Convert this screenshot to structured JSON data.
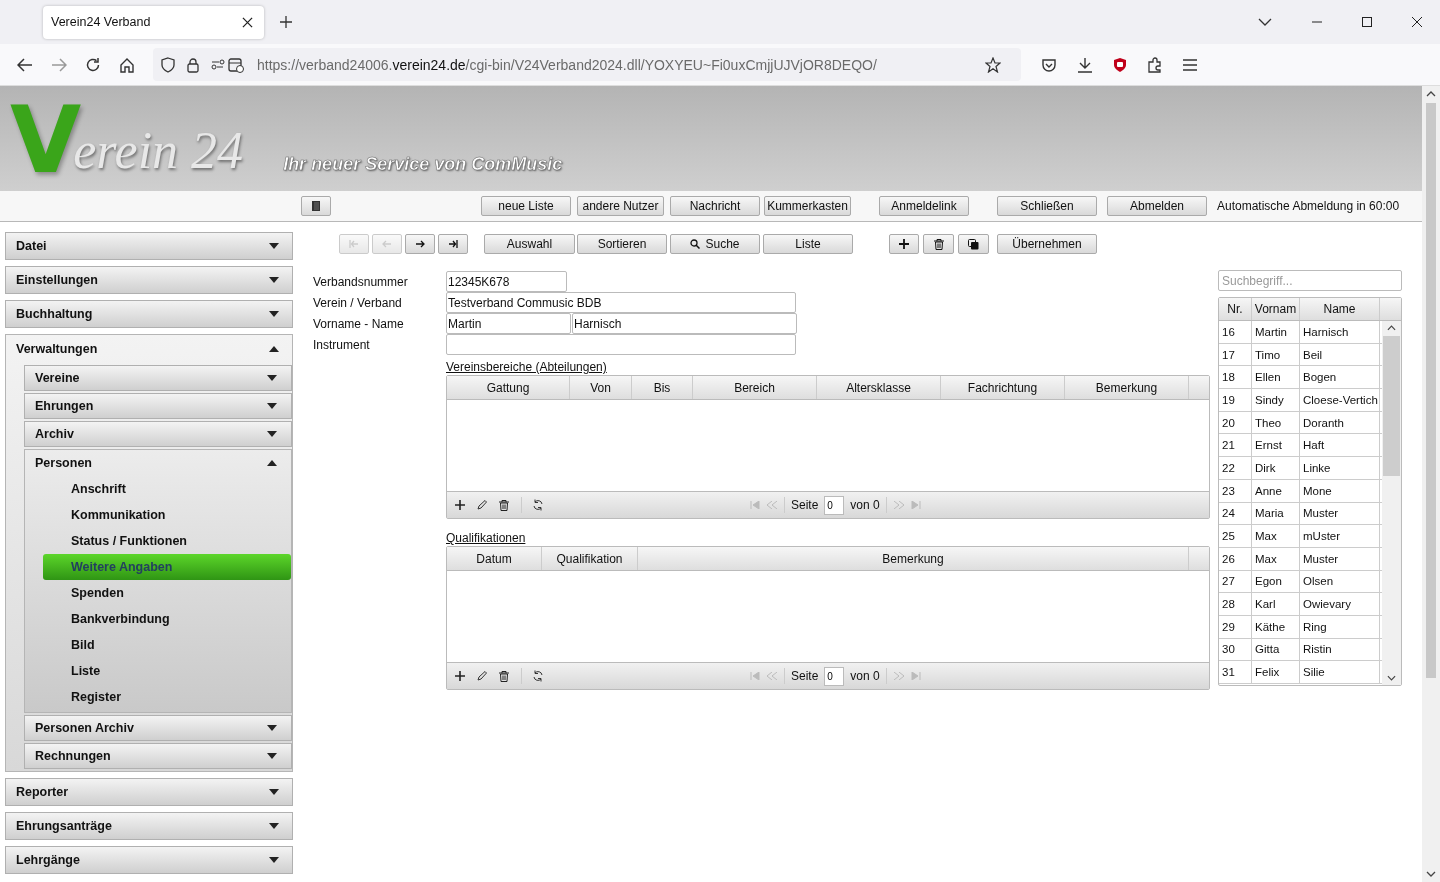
{
  "browser": {
    "tab": {
      "title": "Verein24 Verband"
    },
    "url": "https://verband24006.**verein24.de**/cgi-bin/V24Verband2024.dll/YOXYEU~Fi0uxCmjjUJVjOR8DEQO/"
  },
  "header": {
    "logo": {
      "initial": "V",
      "rest": "erein 24"
    },
    "slogan": "Ihr neuer Service von ComMusic"
  },
  "top_toolbar": {
    "buttons": [
      {
        "kind": "icon"
      },
      {
        "kind": "text",
        "label": "neue Liste"
      },
      {
        "kind": "text",
        "label": "andere Nutzer"
      },
      {
        "kind": "text",
        "label": "Nachricht"
      },
      {
        "kind": "text",
        "label": "Kummerkasten"
      },
      {
        "kind": "text",
        "label": "Anmeldelink"
      },
      {
        "kind": "text",
        "label": "Schließen"
      },
      {
        "kind": "text",
        "label": "Abmelden"
      }
    ],
    "logout_notice": "Automatische Abmeldung in 60:00"
  },
  "nav_toolbar": {
    "buttons": [
      {
        "kind": "first",
        "disabled": true
      },
      {
        "kind": "prev",
        "disabled": true
      },
      {
        "kind": "next",
        "disabled": false
      },
      {
        "kind": "last",
        "disabled": false
      },
      {
        "kind": "text",
        "label": "Auswahl"
      },
      {
        "kind": "text",
        "label": "Sortieren"
      },
      {
        "kind": "search",
        "label": "Suche"
      },
      {
        "kind": "text",
        "label": "Liste"
      },
      {
        "kind": "add"
      },
      {
        "kind": "delete"
      },
      {
        "kind": "copy"
      },
      {
        "kind": "text",
        "label": "Übernehmen"
      }
    ]
  },
  "sidebar": [
    {
      "label": "Datei",
      "expanded": false
    },
    {
      "label": "Einstellungen",
      "expanded": false
    },
    {
      "label": "Buchhaltung",
      "expanded": false
    },
    {
      "label": "Verwaltungen",
      "expanded": true,
      "children": [
        {
          "label": "Vereine",
          "expanded": false
        },
        {
          "label": "Ehrungen",
          "expanded": false
        },
        {
          "label": "Archiv",
          "expanded": false
        },
        {
          "label": "Personen",
          "expanded": true,
          "children": [
            {
              "label": "Anschrift",
              "selected": false
            },
            {
              "label": "Kommunikation",
              "selected": false
            },
            {
              "label": "Status / Funktionen",
              "selected": false
            },
            {
              "label": "Weitere Angaben",
              "selected": true
            },
            {
              "label": "Spenden",
              "selected": false
            },
            {
              "label": "Bankverbindung",
              "selected": false
            },
            {
              "label": "Bild",
              "selected": false
            },
            {
              "label": "Liste",
              "selected": false
            },
            {
              "label": "Register",
              "selected": false
            }
          ]
        },
        {
          "label": "Personen Archiv",
          "expanded": false
        },
        {
          "label": "Rechnungen",
          "expanded": false
        }
      ]
    },
    {
      "label": "Reporter",
      "expanded": false
    },
    {
      "label": "Ehrungsanträge",
      "expanded": false
    },
    {
      "label": "Lehrgänge",
      "expanded": false
    }
  ],
  "form": {
    "fields": [
      {
        "label": "Verbandsnummer",
        "kind": "short",
        "values": [
          "12345K678"
        ]
      },
      {
        "label": "Verein / Verband",
        "kind": "wide",
        "values": [
          "Testverband Commusic BDB"
        ]
      },
      {
        "label": "Vorname - Name",
        "kind": "pair",
        "values": [
          "Martin",
          "Harnisch"
        ]
      },
      {
        "label": "Instrument",
        "kind": "wide"
      }
    ]
  },
  "grids": [
    {
      "title": "Vereinsbereiche (Abteilungen)",
      "columns": [
        "Gattung",
        "Von",
        "Bis",
        "Bereich",
        "Altersklasse",
        "Fachrichtung",
        "Bemerkung"
      ],
      "pager": {
        "page_label": "Seite",
        "page": "0",
        "of": "von 0"
      }
    },
    {
      "title": "Qualifikationen",
      "columns": [
        "Datum",
        "Qualifikation",
        "Bemerkung"
      ],
      "pager": {
        "page_label": "Seite",
        "page": "0",
        "of": "von 0"
      }
    }
  ],
  "person_list": {
    "search": {
      "placeholder": "Suchbegriff..."
    },
    "columns": [
      "Nr.",
      "Vornam",
      "Name"
    ],
    "rows": [
      [
        "16",
        "Martin",
        "Harnisch"
      ],
      [
        "17",
        "Timo",
        "Beil"
      ],
      [
        "18",
        "Ellen",
        "Bogen"
      ],
      [
        "19",
        "Sindy",
        "Cloese-Vertich"
      ],
      [
        "20",
        "Theo",
        "Doranth"
      ],
      [
        "21",
        "Ernst",
        "Haft"
      ],
      [
        "22",
        "Dirk",
        "Linke"
      ],
      [
        "23",
        "Anne",
        "Mone"
      ],
      [
        "24",
        "Maria",
        "Muster"
      ],
      [
        "25",
        "Max",
        "mUster"
      ],
      [
        "26",
        "Max",
        "Muster"
      ],
      [
        "27",
        "Egon",
        "Olsen"
      ],
      [
        "28",
        "Karl",
        "Owievary"
      ],
      [
        "29",
        "Käthe",
        "Ring"
      ],
      [
        "30",
        "Gitta",
        "Ristin"
      ],
      [
        "31",
        "Felix",
        "Silie"
      ]
    ]
  }
}
